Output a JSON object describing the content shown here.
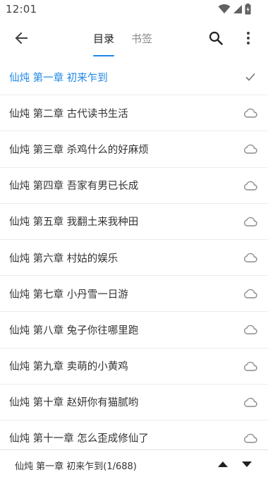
{
  "status_bar": {
    "time": "12:01",
    "icons": [
      "wifi-icon",
      "signal-icon",
      "battery-icon"
    ]
  },
  "app_bar": {
    "back_icon": "arrow-left-icon",
    "tabs": [
      {
        "label": "目录",
        "active": true
      },
      {
        "label": "书签",
        "active": false
      }
    ],
    "search_icon": "search-icon",
    "more_icon": "more-vertical-icon",
    "accent_color": "#1e88e5"
  },
  "chapters": [
    {
      "title": "仙炖 第一章 初来乍到",
      "status": "current",
      "icon": "check-icon"
    },
    {
      "title": "仙炖 第二章 古代读书生活",
      "status": "cloud",
      "icon": "cloud-icon"
    },
    {
      "title": "仙炖 第三章 杀鸡什么的好麻烦",
      "status": "cloud",
      "icon": "cloud-icon"
    },
    {
      "title": "仙炖 第四章 吾家有男已长成",
      "status": "cloud",
      "icon": "cloud-icon"
    },
    {
      "title": "仙炖 第五章 我翻土来我种田",
      "status": "cloud",
      "icon": "cloud-icon"
    },
    {
      "title": "仙炖 第六章 村姑的娱乐",
      "status": "cloud",
      "icon": "cloud-icon"
    },
    {
      "title": "仙炖 第七章 小丹雪一日游",
      "status": "cloud",
      "icon": "cloud-icon"
    },
    {
      "title": "仙炖 第八章 兔子你往哪里跑",
      "status": "cloud",
      "icon": "cloud-icon"
    },
    {
      "title": "仙炖 第九章 卖萌的小黄鸡",
      "status": "cloud",
      "icon": "cloud-icon"
    },
    {
      "title": "仙炖 第十章 赵妍你有猫腻哟",
      "status": "cloud",
      "icon": "cloud-icon"
    },
    {
      "title": "仙炖 第十一章 怎么歪成修仙了",
      "status": "cloud",
      "icon": "cloud-icon"
    }
  ],
  "bottom_bar": {
    "progress": "仙炖 第一章 初来乍到(1/688)",
    "up_icon": "triangle-up-icon",
    "down_icon": "triangle-down-icon"
  }
}
